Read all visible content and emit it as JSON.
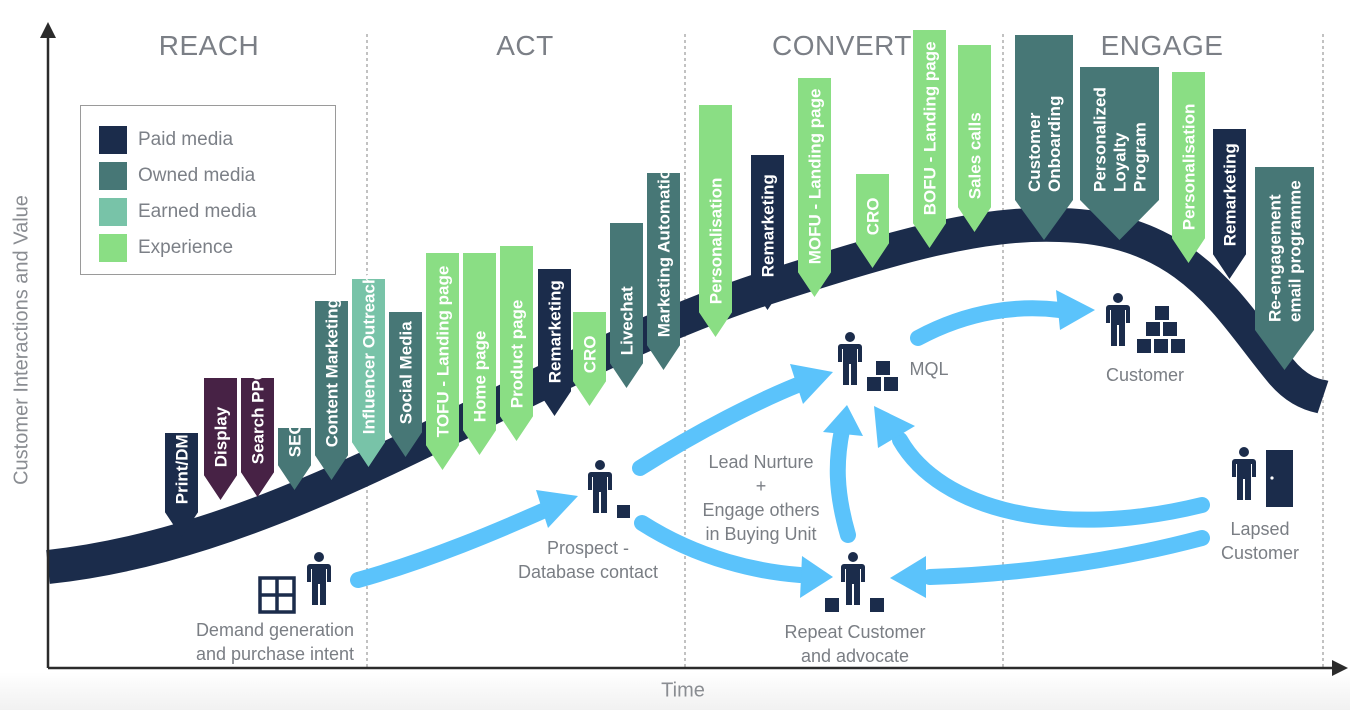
{
  "axes": {
    "y_label": "Customer Interactions and Value",
    "x_label": "Time"
  },
  "stages": [
    {
      "id": "reach",
      "label": "REACH"
    },
    {
      "id": "act",
      "label": "ACT"
    },
    {
      "id": "convert",
      "label": "CONVERT"
    },
    {
      "id": "engage",
      "label": "ENGAGE"
    }
  ],
  "legend": {
    "items": [
      {
        "key": "paid",
        "label": "Paid media",
        "color": "#1b2c4b"
      },
      {
        "key": "owned",
        "label": "Owned media",
        "color": "#477776"
      },
      {
        "key": "earned",
        "label": "Earned media",
        "color": "#78c3a8"
      },
      {
        "key": "experience",
        "label": "Experience",
        "color": "#8ade84"
      }
    ]
  },
  "colors": {
    "curve": "#1b2c4b",
    "arrows": "#5bc3fb",
    "display_purple": "#472245",
    "icon": "#1b2c4b",
    "axis": "#2b2b2b",
    "divider": "#9a9a9a"
  },
  "tactics": [
    {
      "stage": "reach",
      "type": "paid",
      "lines": [
        "Print/DM"
      ]
    },
    {
      "stage": "reach",
      "type": "display",
      "lines": [
        "Display"
      ]
    },
    {
      "stage": "reach",
      "type": "display",
      "lines": [
        "Search PPC"
      ]
    },
    {
      "stage": "reach",
      "type": "owned",
      "lines": [
        "SEO"
      ]
    },
    {
      "stage": "reach",
      "type": "owned",
      "lines": [
        "Content Marketing"
      ]
    },
    {
      "stage": "reach",
      "type": "earned",
      "lines": [
        "Influencer Outreach"
      ]
    },
    {
      "stage": "act",
      "type": "owned",
      "lines": [
        "Social Media"
      ]
    },
    {
      "stage": "act",
      "type": "experience",
      "lines": [
        "TOFU - Landing page"
      ]
    },
    {
      "stage": "act",
      "type": "experience",
      "lines": [
        "Home page"
      ]
    },
    {
      "stage": "act",
      "type": "experience",
      "lines": [
        "Product page"
      ]
    },
    {
      "stage": "act",
      "type": "paid",
      "lines": [
        "Remarketing"
      ]
    },
    {
      "stage": "act",
      "type": "experience",
      "lines": [
        "CRO"
      ]
    },
    {
      "stage": "act",
      "type": "owned",
      "lines": [
        "Livechat"
      ]
    },
    {
      "stage": "act",
      "type": "owned",
      "lines": [
        "Marketing Automation"
      ]
    },
    {
      "stage": "convert",
      "type": "experience",
      "lines": [
        "Personalisation"
      ]
    },
    {
      "stage": "convert",
      "type": "paid",
      "lines": [
        "Remarketing"
      ]
    },
    {
      "stage": "convert",
      "type": "experience",
      "lines": [
        "MOFU - Landing page"
      ]
    },
    {
      "stage": "convert",
      "type": "experience",
      "lines": [
        "CRO"
      ]
    },
    {
      "stage": "convert",
      "type": "experience",
      "lines": [
        "BOFU - Landing page"
      ]
    },
    {
      "stage": "convert",
      "type": "experience",
      "lines": [
        "Sales calls"
      ]
    },
    {
      "stage": "engage",
      "type": "owned",
      "lines": [
        "Customer",
        "Onboarding"
      ]
    },
    {
      "stage": "engage",
      "type": "owned",
      "lines": [
        "Personalized",
        "Loyalty",
        "Program"
      ]
    },
    {
      "stage": "engage",
      "type": "experience",
      "lines": [
        "Personalisation"
      ]
    },
    {
      "stage": "engage",
      "type": "paid",
      "lines": [
        "Remarketing"
      ]
    },
    {
      "stage": "engage",
      "type": "owned",
      "lines": [
        "Re-engagement",
        "email programme"
      ]
    }
  ],
  "nodes": {
    "demand": {
      "lines": [
        "Demand generation",
        "and purchase intent"
      ],
      "icon": "window-person"
    },
    "prospect": {
      "lines": [
        "Prospect  -",
        "Database contact"
      ],
      "icon": "person-one-box"
    },
    "nurture": {
      "lines": [
        "Lead Nurture",
        "+",
        "Engage others",
        "in Buying Unit"
      ]
    },
    "mql": {
      "lines": [
        "MQL"
      ],
      "icon": "person-three-boxes"
    },
    "repeat": {
      "lines": [
        "Repeat Customer",
        "and advocate"
      ],
      "icon": "person-two-boxes"
    },
    "customer": {
      "lines": [
        "Customer"
      ],
      "icon": "person-six-boxes"
    },
    "lapsed": {
      "lines": [
        "Lapsed",
        "Customer"
      ],
      "icon": "person-door"
    }
  }
}
